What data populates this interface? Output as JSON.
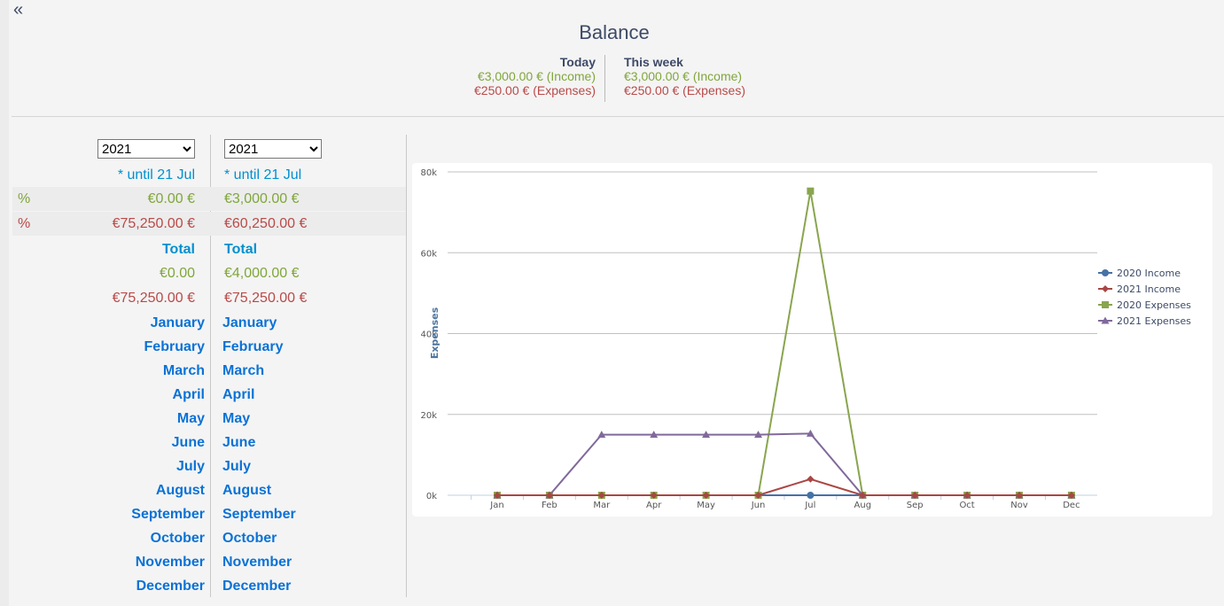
{
  "header": {
    "collapse_icon": "double-chevron-left-icon",
    "title": "Balance",
    "today": {
      "label": "Today",
      "income": "€3,000.00 € (Income)",
      "expenses": "€250.00 € (Expenses)"
    },
    "week": {
      "label": "This week",
      "income": "€3,000.00 € (Income)",
      "expenses": "€250.00 € (Expenses)"
    }
  },
  "left": {
    "year1": "2021",
    "year2": "2021",
    "until1": "* until 21 Jul",
    "until2": "* until 21 Jul",
    "pct": "%",
    "income1": "€0.00 €",
    "income2": "€3,000.00 €",
    "expenses1": "€75,250.00 €",
    "expenses2": "€60,250.00 €",
    "total1": "Total",
    "total2": "Total",
    "total_income1": "€0.00",
    "total_income2": "€4,000.00 €",
    "total_expenses1": "€75,250.00 €",
    "total_expenses2": "€75,250.00 €",
    "months": [
      "January",
      "February",
      "March",
      "April",
      "May",
      "June",
      "July",
      "August",
      "September",
      "October",
      "November",
      "December"
    ]
  },
  "colors": {
    "income": "#7fa63b",
    "expenses": "#b94a48",
    "link": "#0a72d6"
  },
  "chart_data": {
    "type": "line",
    "ylabel": "Expenses",
    "ylim": [
      0,
      80000
    ],
    "yticks": [
      "0k",
      "20k",
      "40k",
      "60k",
      "80k"
    ],
    "grid": true,
    "legend": "right",
    "categories": [
      "Jan",
      "Feb",
      "Mar",
      "Apr",
      "May",
      "Jun",
      "Jul",
      "Aug",
      "Sep",
      "Oct",
      "Nov",
      "Dec"
    ],
    "series": [
      {
        "name": "2020 Income",
        "color": "#4572a7",
        "marker": "circle",
        "values": [
          0,
          0,
          0,
          0,
          0,
          0,
          0,
          0,
          0,
          0,
          0,
          0
        ]
      },
      {
        "name": "2021 Income",
        "color": "#aa4643",
        "marker": "diamond",
        "values": [
          0,
          0,
          0,
          0,
          0,
          0,
          4000,
          0,
          0,
          0,
          0,
          0
        ]
      },
      {
        "name": "2020 Expenses",
        "color": "#89a54e",
        "marker": "square",
        "values": [
          0,
          0,
          0,
          0,
          0,
          0,
          75250,
          0,
          0,
          0,
          0,
          0
        ]
      },
      {
        "name": "2021 Expenses",
        "color": "#80699b",
        "marker": "triangle",
        "values": [
          0,
          0,
          15000,
          15000,
          15000,
          15000,
          15250,
          0,
          0,
          0,
          0,
          0
        ]
      }
    ]
  }
}
